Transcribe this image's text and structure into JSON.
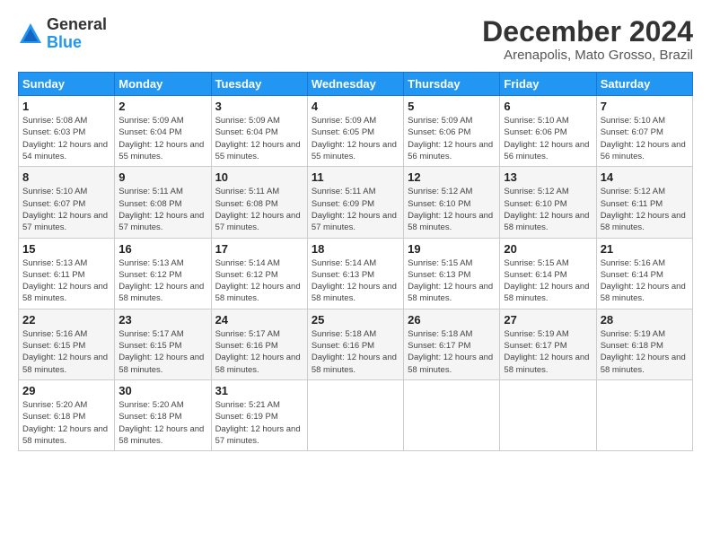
{
  "logo": {
    "general": "General",
    "blue": "Blue"
  },
  "title": "December 2024",
  "location": "Arenapolis, Mato Grosso, Brazil",
  "days_header": [
    "Sunday",
    "Monday",
    "Tuesday",
    "Wednesday",
    "Thursday",
    "Friday",
    "Saturday"
  ],
  "weeks": [
    [
      {
        "day": "1",
        "sunrise": "5:08 AM",
        "sunset": "6:03 PM",
        "daylight": "12 hours and 54 minutes."
      },
      {
        "day": "2",
        "sunrise": "5:09 AM",
        "sunset": "6:04 PM",
        "daylight": "12 hours and 55 minutes."
      },
      {
        "day": "3",
        "sunrise": "5:09 AM",
        "sunset": "6:04 PM",
        "daylight": "12 hours and 55 minutes."
      },
      {
        "day": "4",
        "sunrise": "5:09 AM",
        "sunset": "6:05 PM",
        "daylight": "12 hours and 55 minutes."
      },
      {
        "day": "5",
        "sunrise": "5:09 AM",
        "sunset": "6:06 PM",
        "daylight": "12 hours and 56 minutes."
      },
      {
        "day": "6",
        "sunrise": "5:10 AM",
        "sunset": "6:06 PM",
        "daylight": "12 hours and 56 minutes."
      },
      {
        "day": "7",
        "sunrise": "5:10 AM",
        "sunset": "6:07 PM",
        "daylight": "12 hours and 56 minutes."
      }
    ],
    [
      {
        "day": "8",
        "sunrise": "5:10 AM",
        "sunset": "6:07 PM",
        "daylight": "12 hours and 57 minutes."
      },
      {
        "day": "9",
        "sunrise": "5:11 AM",
        "sunset": "6:08 PM",
        "daylight": "12 hours and 57 minutes."
      },
      {
        "day": "10",
        "sunrise": "5:11 AM",
        "sunset": "6:08 PM",
        "daylight": "12 hours and 57 minutes."
      },
      {
        "day": "11",
        "sunrise": "5:11 AM",
        "sunset": "6:09 PM",
        "daylight": "12 hours and 57 minutes."
      },
      {
        "day": "12",
        "sunrise": "5:12 AM",
        "sunset": "6:10 PM",
        "daylight": "12 hours and 58 minutes."
      },
      {
        "day": "13",
        "sunrise": "5:12 AM",
        "sunset": "6:10 PM",
        "daylight": "12 hours and 58 minutes."
      },
      {
        "day": "14",
        "sunrise": "5:12 AM",
        "sunset": "6:11 PM",
        "daylight": "12 hours and 58 minutes."
      }
    ],
    [
      {
        "day": "15",
        "sunrise": "5:13 AM",
        "sunset": "6:11 PM",
        "daylight": "12 hours and 58 minutes."
      },
      {
        "day": "16",
        "sunrise": "5:13 AM",
        "sunset": "6:12 PM",
        "daylight": "12 hours and 58 minutes."
      },
      {
        "day": "17",
        "sunrise": "5:14 AM",
        "sunset": "6:12 PM",
        "daylight": "12 hours and 58 minutes."
      },
      {
        "day": "18",
        "sunrise": "5:14 AM",
        "sunset": "6:13 PM",
        "daylight": "12 hours and 58 minutes."
      },
      {
        "day": "19",
        "sunrise": "5:15 AM",
        "sunset": "6:13 PM",
        "daylight": "12 hours and 58 minutes."
      },
      {
        "day": "20",
        "sunrise": "5:15 AM",
        "sunset": "6:14 PM",
        "daylight": "12 hours and 58 minutes."
      },
      {
        "day": "21",
        "sunrise": "5:16 AM",
        "sunset": "6:14 PM",
        "daylight": "12 hours and 58 minutes."
      }
    ],
    [
      {
        "day": "22",
        "sunrise": "5:16 AM",
        "sunset": "6:15 PM",
        "daylight": "12 hours and 58 minutes."
      },
      {
        "day": "23",
        "sunrise": "5:17 AM",
        "sunset": "6:15 PM",
        "daylight": "12 hours and 58 minutes."
      },
      {
        "day": "24",
        "sunrise": "5:17 AM",
        "sunset": "6:16 PM",
        "daylight": "12 hours and 58 minutes."
      },
      {
        "day": "25",
        "sunrise": "5:18 AM",
        "sunset": "6:16 PM",
        "daylight": "12 hours and 58 minutes."
      },
      {
        "day": "26",
        "sunrise": "5:18 AM",
        "sunset": "6:17 PM",
        "daylight": "12 hours and 58 minutes."
      },
      {
        "day": "27",
        "sunrise": "5:19 AM",
        "sunset": "6:17 PM",
        "daylight": "12 hours and 58 minutes."
      },
      {
        "day": "28",
        "sunrise": "5:19 AM",
        "sunset": "6:18 PM",
        "daylight": "12 hours and 58 minutes."
      }
    ],
    [
      {
        "day": "29",
        "sunrise": "5:20 AM",
        "sunset": "6:18 PM",
        "daylight": "12 hours and 58 minutes."
      },
      {
        "day": "30",
        "sunrise": "5:20 AM",
        "sunset": "6:18 PM",
        "daylight": "12 hours and 58 minutes."
      },
      {
        "day": "31",
        "sunrise": "5:21 AM",
        "sunset": "6:19 PM",
        "daylight": "12 hours and 57 minutes."
      },
      null,
      null,
      null,
      null
    ]
  ]
}
